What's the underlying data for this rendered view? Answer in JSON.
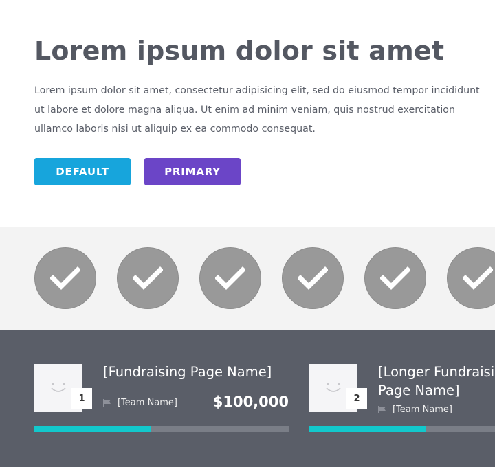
{
  "hero": {
    "title": "Lorem ipsum dolor sit amet",
    "body": "Lorem ipsum dolor sit amet, consectetur adipisicing elit, sed do eiusmod tempor incididunt ut labore et dolore magna aliqua. Ut enim ad minim veniam, quis nostrud exercitation ullamco laboris nisi ut aliquip ex ea commodo consequat.",
    "buttons": {
      "default_label": "DEFAULT",
      "primary_label": "PRIMARY"
    }
  },
  "colors": {
    "default_button": "#17a5dc",
    "primary_button": "#6b45c7",
    "circle": "#999999",
    "band_bg": "#f3f3f3",
    "dark_bg": "#5a5e68",
    "progress": "#12c8cc"
  },
  "check_circles": [
    {
      "icon": "check-icon"
    },
    {
      "icon": "check-icon"
    },
    {
      "icon": "check-icon"
    },
    {
      "icon": "check-icon"
    },
    {
      "icon": "check-icon"
    },
    {
      "icon": "check-icon"
    }
  ],
  "fundraisers": [
    {
      "rank": "1",
      "name": "[Fundraising Page Name]",
      "team": "[Team Name]",
      "amount": "$100,000",
      "progress": 0.46
    },
    {
      "rank": "2",
      "name": "[Longer Fundraising Page Name]",
      "team": "[Team Name]",
      "amount": "",
      "progress": 0.46
    }
  ]
}
